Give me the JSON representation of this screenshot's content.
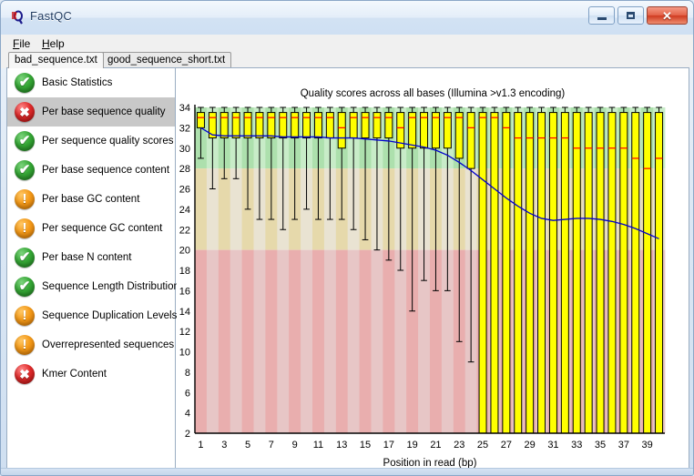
{
  "window": {
    "title": "FastQC",
    "app_icon": "fastqc-logo-icon",
    "buttons": {
      "minimize": "minimize-icon",
      "maximize": "maximize-icon",
      "close": "✕"
    }
  },
  "menu": {
    "items": [
      {
        "label": "File",
        "mnemonic": "F"
      },
      {
        "label": "Help",
        "mnemonic": "H"
      }
    ]
  },
  "tabs": [
    {
      "label": "bad_sequence.txt",
      "active": true
    },
    {
      "label": "good_sequence_short.txt",
      "active": false
    }
  ],
  "sidebar": {
    "items": [
      {
        "label": "Basic Statistics",
        "status": "pass",
        "selected": false
      },
      {
        "label": "Per base sequence quality",
        "status": "fail",
        "selected": true
      },
      {
        "label": "Per sequence quality scores",
        "status": "pass",
        "selected": false
      },
      {
        "label": "Per base sequence content",
        "status": "pass",
        "selected": false
      },
      {
        "label": "Per base GC content",
        "status": "warn",
        "selected": false
      },
      {
        "label": "Per sequence GC content",
        "status": "warn",
        "selected": false
      },
      {
        "label": "Per base N content",
        "status": "pass",
        "selected": false
      },
      {
        "label": "Sequence Length Distribution",
        "status": "pass",
        "selected": false
      },
      {
        "label": "Sequence Duplication Levels",
        "status": "warn",
        "selected": false
      },
      {
        "label": "Overrepresented sequences",
        "status": "warn",
        "selected": false
      },
      {
        "label": "Kmer Content",
        "status": "fail",
        "selected": false
      }
    ],
    "status_symbols": {
      "pass": "✔",
      "warn": "!",
      "fail": "✖"
    }
  },
  "colors": {
    "pass": "#36a836",
    "warn": "#f59a18",
    "fail": "#e02b2b",
    "box_fill": "#ffff00",
    "median_line": "#ff0000",
    "mean_line": "#0000cc",
    "band_good_a": "#ade0ad",
    "band_good_b": "#c8ecc8",
    "band_mid_a": "#e6d9ab",
    "band_mid_b": "#e9e3d2",
    "band_bad_a": "#e9aeae",
    "band_bad_b": "#e7c6c6"
  },
  "chart_data": {
    "type": "box",
    "title": "Quality scores across all bases (Illumina >v1.3 encoding)",
    "xlabel": "Position in read (bp)",
    "ylabel": "",
    "ylim": [
      2,
      34
    ],
    "ytick_step": 2,
    "yticks": [
      2,
      4,
      6,
      8,
      10,
      12,
      14,
      16,
      18,
      20,
      22,
      24,
      26,
      28,
      30,
      32,
      34
    ],
    "xticks": [
      1,
      3,
      5,
      7,
      9,
      11,
      13,
      15,
      17,
      19,
      21,
      23,
      25,
      27,
      29,
      31,
      33,
      35,
      37,
      39
    ],
    "x": [
      1,
      2,
      3,
      4,
      5,
      6,
      7,
      8,
      9,
      10,
      11,
      12,
      13,
      14,
      15,
      16,
      17,
      18,
      19,
      20,
      21,
      22,
      23,
      24,
      25,
      26,
      27,
      28,
      29,
      30,
      31,
      32,
      33,
      34,
      35,
      36,
      37,
      38,
      39,
      40
    ],
    "background_bands": [
      {
        "from": 28,
        "to": 34,
        "quality": "good"
      },
      {
        "from": 20,
        "to": 28,
        "quality": "medium"
      },
      {
        "from": 2,
        "to": 20,
        "quality": "bad"
      }
    ],
    "legend": [],
    "grid": false,
    "series": [
      {
        "name": "Mean quality",
        "type": "line",
        "color": "#0000cc",
        "values": [
          32.0,
          31.3,
          31.2,
          31.2,
          31.2,
          31.2,
          31.2,
          31.1,
          31.1,
          31.1,
          31.1,
          31.0,
          31.0,
          31.0,
          30.9,
          30.8,
          30.7,
          30.5,
          30.3,
          30.1,
          29.8,
          29.3,
          28.6,
          27.8,
          26.9,
          26.0,
          25.1,
          24.3,
          23.6,
          23.1,
          22.9,
          23.0,
          23.1,
          23.1,
          23.0,
          22.8,
          22.5,
          22.1,
          21.6,
          21.1
        ]
      },
      {
        "name": "Per-base quality boxes",
        "type": "box",
        "lower_whisker": [
          29.0,
          26.0,
          27.0,
          27.0,
          24.0,
          23.0,
          23.0,
          22.0,
          23.0,
          24.0,
          23.0,
          23.0,
          23.0,
          22.0,
          21.0,
          20.0,
          19.0,
          18.0,
          14.0,
          17.0,
          16.0,
          16.0,
          11.0,
          9.0,
          2.0,
          2.0,
          2.0,
          2.0,
          2.0,
          2.0,
          2.0,
          2.0,
          5.0,
          6.0,
          7.0,
          8.0,
          2.0,
          2.0,
          2.0,
          2.0
        ],
        "q1": [
          32.0,
          31.0,
          31.0,
          31.0,
          31.0,
          31.0,
          31.0,
          31.0,
          31.0,
          31.0,
          31.0,
          31.0,
          30.0,
          31.0,
          31.0,
          31.0,
          31.0,
          30.0,
          30.0,
          30.0,
          30.0,
          30.0,
          29.0,
          28.0,
          2.0,
          2.0,
          2.0,
          2.0,
          2.0,
          2.0,
          2.0,
          2.0,
          2.0,
          2.0,
          2.0,
          2.0,
          2.0,
          2.0,
          2.0,
          2.0
        ],
        "median": [
          33.0,
          33.0,
          33.0,
          33.0,
          33.0,
          33.0,
          33.0,
          33.0,
          33.0,
          33.0,
          33.0,
          33.0,
          32.0,
          33.0,
          33.0,
          33.0,
          33.0,
          32.0,
          33.0,
          33.0,
          33.0,
          33.0,
          33.0,
          32.0,
          33.0,
          33.0,
          32.0,
          31.0,
          31.0,
          31.0,
          31.0,
          31.0,
          30.0,
          30.0,
          30.0,
          30.0,
          30.0,
          29.0,
          28.0,
          29.0
        ],
        "q3": [
          33.5,
          33.5,
          33.5,
          33.5,
          33.5,
          33.5,
          33.5,
          33.5,
          33.5,
          33.5,
          33.5,
          33.5,
          33.5,
          33.5,
          33.5,
          33.5,
          33.5,
          33.5,
          33.5,
          33.5,
          33.5,
          33.5,
          33.5,
          33.5,
          33.5,
          33.5,
          33.5,
          33.5,
          33.5,
          33.5,
          33.5,
          33.5,
          33.5,
          33.5,
          33.5,
          33.5,
          33.5,
          33.5,
          33.5,
          33.5
        ],
        "upper_whisker": [
          34.0,
          34.0,
          34.0,
          34.0,
          34.0,
          34.0,
          34.0,
          34.0,
          34.0,
          34.0,
          34.0,
          34.0,
          34.0,
          34.0,
          34.0,
          34.0,
          34.0,
          34.0,
          34.0,
          34.0,
          34.0,
          34.0,
          34.0,
          34.0,
          34.0,
          34.0,
          34.0,
          34.0,
          34.0,
          34.0,
          34.0,
          34.0,
          34.0,
          34.0,
          34.0,
          34.0,
          34.0,
          34.0,
          34.0,
          34.0
        ]
      }
    ]
  }
}
